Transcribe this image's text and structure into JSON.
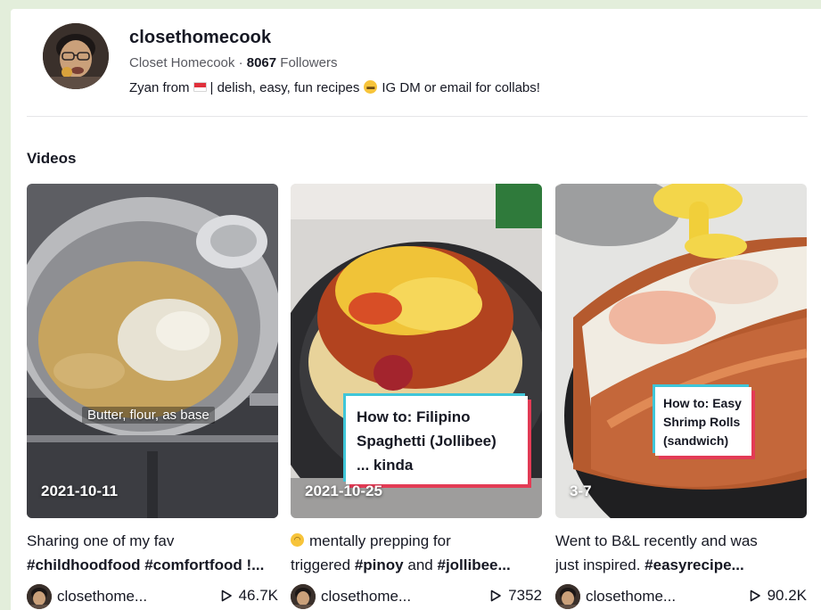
{
  "profile": {
    "username": "closethomecook",
    "nickname": "Closet Homecook",
    "separator": "·",
    "followers_count": "8067",
    "followers_label": "Followers",
    "bio_prefix": "Zyan from",
    "bio_middle": "| delish, easy, fun recipes",
    "bio_suffix": "IG DM or email for collabs!"
  },
  "videos_section": {
    "title": "Videos"
  },
  "videos": [
    {
      "date": "2021-10-11",
      "overlay_text": "Butter, flour, as base",
      "desc_line1": "Sharing one of my fav",
      "desc_line2": "#childhoodfood #comfortfood !...",
      "author": "closethome...",
      "plays": "46.7K"
    },
    {
      "date": "2021-10-25",
      "howto_line1": "How to: Filipino",
      "howto_line2": "Spaghetti (Jollibee)",
      "howto_line3": "... kinda",
      "desc_emoji": "🙃",
      "desc_line1": "mentally prepping for",
      "desc_line2_prefix": "triggered",
      "desc_line2_tag1": "#pinoy",
      "desc_line2_and": "and",
      "desc_line2_tag2": "#jollibee...",
      "author": "closethome...",
      "plays": "7352"
    },
    {
      "date": "3-7",
      "howto_line1": "How to: Easy",
      "howto_line2": "Shrimp Rolls",
      "howto_line3": "(sandwich)",
      "desc_line1": "Went to B&L recently and was",
      "desc_line2_prefix": "just inspired.",
      "desc_line2_tag": "#easyrecipe...",
      "author": "closethome...",
      "plays": "90.2K"
    }
  ],
  "colors": {
    "page_bg": "#e3eedb",
    "text_primary": "#161823",
    "text_secondary": "#57585f",
    "accent_red": "#e33b55",
    "accent_cyan": "#3fc6d8"
  },
  "icons": {
    "play": "play-triangle-outline-icon",
    "flag": "indonesia-flag-icon",
    "emoji": "grinning-face-icon"
  }
}
